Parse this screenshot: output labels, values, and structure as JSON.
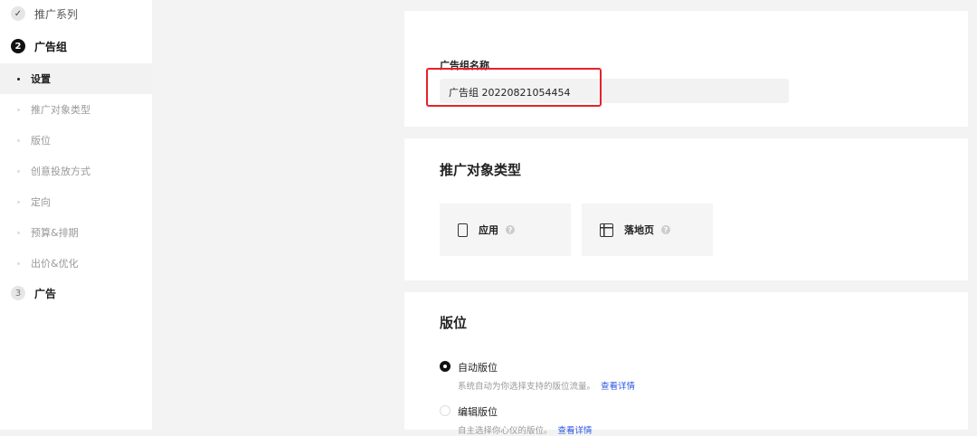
{
  "sidebar": {
    "step1": {
      "label": "推广系列",
      "icon": "check-icon"
    },
    "step2": {
      "number": "2",
      "label": "广告组"
    },
    "sub_items": [
      {
        "label": "设置",
        "active": true
      },
      {
        "label": "推广对象类型"
      },
      {
        "label": "版位"
      },
      {
        "label": "创意投放方式"
      },
      {
        "label": "定向"
      },
      {
        "label": "预算&排期"
      },
      {
        "label": "出价&优化"
      }
    ],
    "step3": {
      "number": "3",
      "label": "广告"
    }
  },
  "ad_group_name": {
    "label": "广告组名称",
    "value": "广告组 20220821054454",
    "highlight_color": "#e8212a"
  },
  "promo_type": {
    "title": "推广对象类型",
    "options": [
      {
        "label": "应用",
        "icon": "phone-icon"
      },
      {
        "label": "落地页",
        "icon": "layout-icon"
      }
    ],
    "help": "?"
  },
  "placement": {
    "title": "版位",
    "options": [
      {
        "label": "自动版位",
        "selected": true,
        "desc": "系统自动为你选择支持的版位流量。",
        "link": "查看详情"
      },
      {
        "label": "编辑版位",
        "selected": false,
        "desc": "自主选择你心仪的版位。",
        "link": "查看详情"
      }
    ]
  }
}
